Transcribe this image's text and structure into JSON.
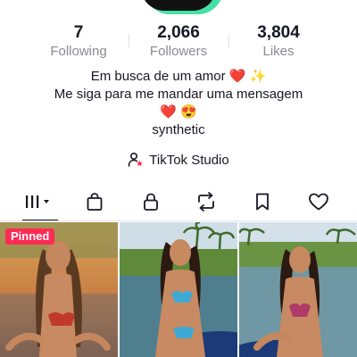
{
  "stats": [
    {
      "value": "7",
      "label": "Following"
    },
    {
      "value": "2,066",
      "label": "Followers"
    },
    {
      "value": "3,804",
      "label": "Likes"
    }
  ],
  "bio": {
    "line1_text": "Em busca de um amor",
    "line1_emoji1": "❤️",
    "line1_emoji2": "✨",
    "line2_text": "Me siga para me mandar uma mensagem",
    "line3_emoji1": "❤️",
    "line3_emoji2": "😍",
    "line4_text": "synthetic"
  },
  "studio": {
    "label": "TikTok Studio",
    "icon": "person-star-icon"
  },
  "tabs": [
    {
      "icon": "videos-grid-icon",
      "active": true
    },
    {
      "icon": "shop-bag-icon"
    },
    {
      "icon": "lock-icon"
    },
    {
      "icon": "repost-icon"
    },
    {
      "icon": "bookmark-icon"
    },
    {
      "icon": "heart-icon"
    }
  ],
  "videos": [
    {
      "badge": "Pinned"
    },
    {},
    {}
  ],
  "colors": {
    "accent": "#fe2c55",
    "text": "#161823",
    "muted": "#8a8b91"
  }
}
